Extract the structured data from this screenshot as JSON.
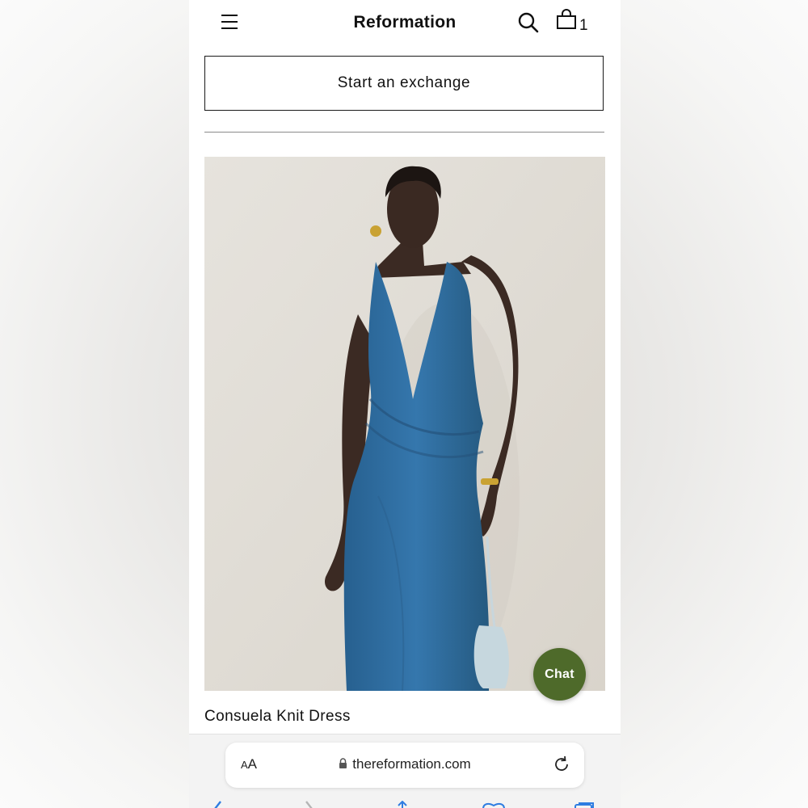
{
  "header": {
    "brand": "Reformation",
    "cart_count": "1",
    "icons": [
      "menu-icon",
      "search-icon",
      "shopping-bag-icon"
    ]
  },
  "actions": {
    "exchange_label": "Start an exchange"
  },
  "product": {
    "name": "Consuela Knit Dress",
    "dress_color": "#2f6ea3"
  },
  "chat": {
    "label": "Chat",
    "color": "#4e6a2a"
  },
  "browser": {
    "text_size_label_small": "A",
    "text_size_label_large": "A",
    "url": "thereformation.com",
    "icons": [
      "lock-icon",
      "reload-icon",
      "back-icon",
      "forward-icon",
      "share-icon",
      "bookmarks-icon",
      "tabs-icon"
    ]
  }
}
